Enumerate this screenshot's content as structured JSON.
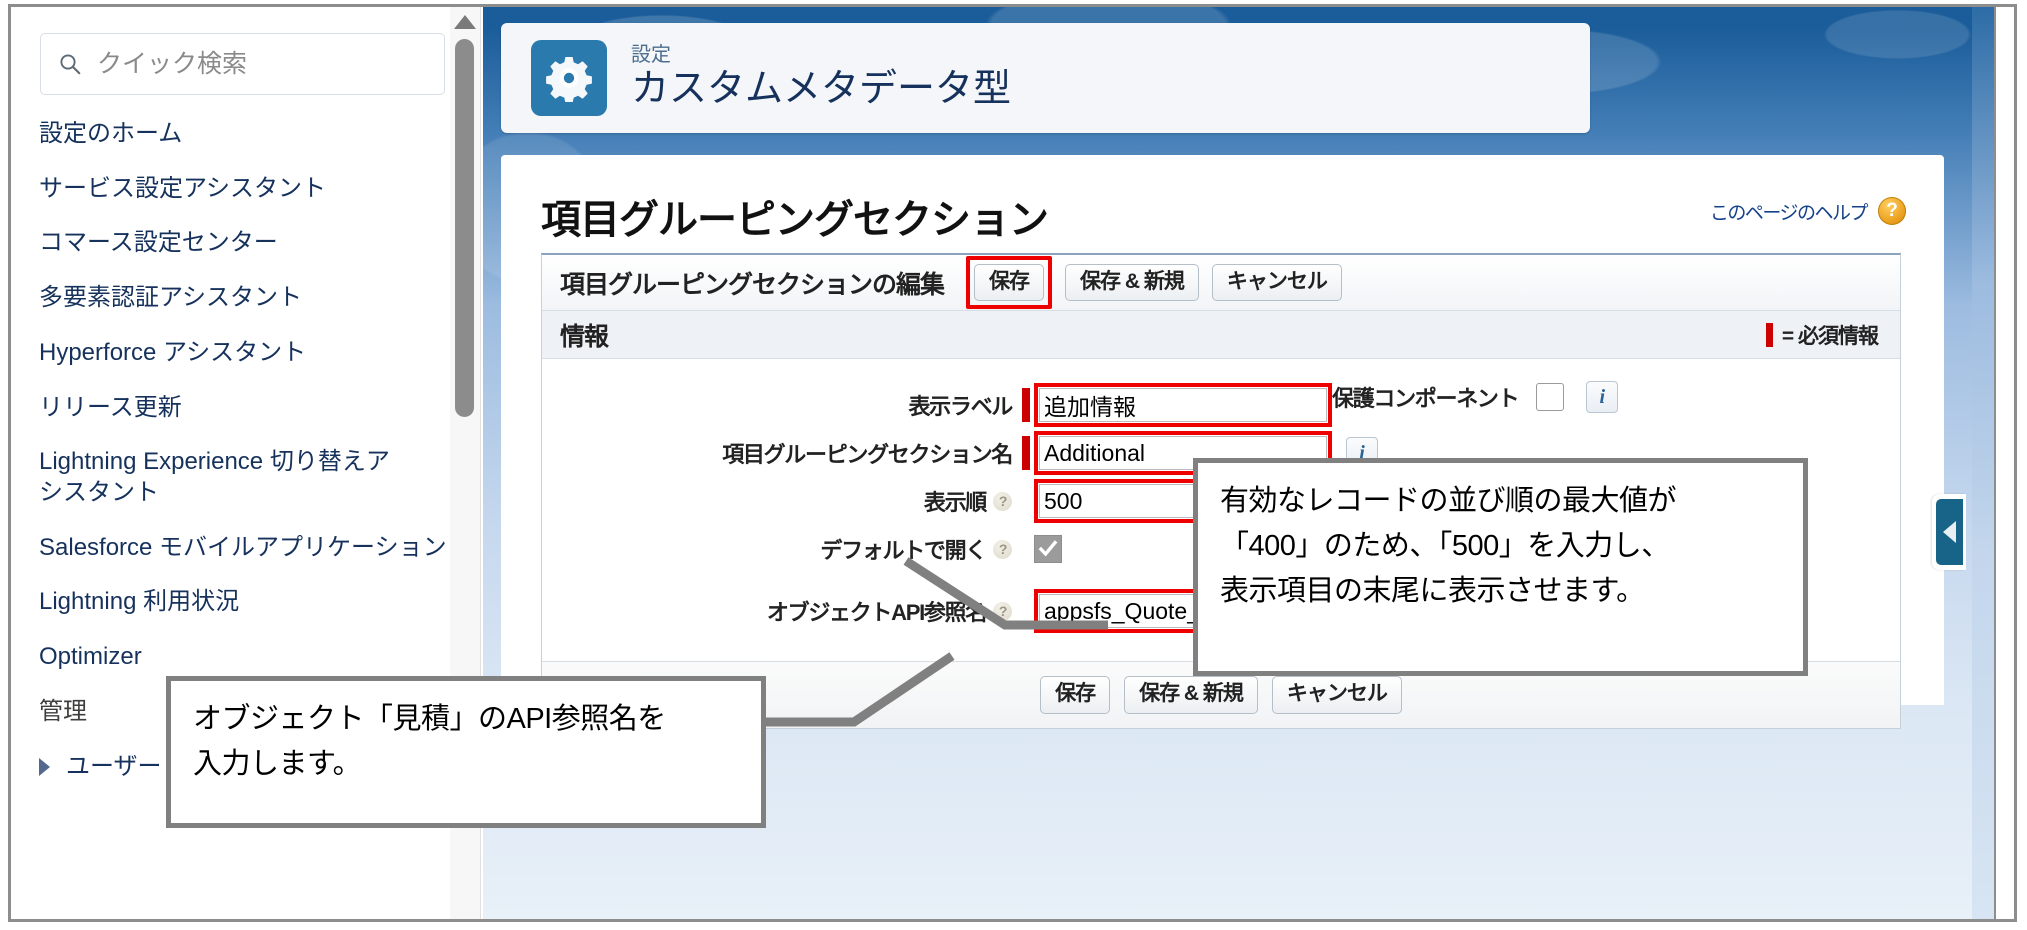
{
  "sidebar": {
    "search": {
      "placeholder": "クイック検索",
      "value": "",
      "icon": "search-icon"
    },
    "items": [
      {
        "label": "設定のホーム",
        "expandable": false
      },
      {
        "label": "サービス設定アシスタント",
        "expandable": false
      },
      {
        "label": "コマース設定センター",
        "expandable": false
      },
      {
        "label": "多要素認証アシスタント",
        "expandable": false
      },
      {
        "label": "Hyperforce アシスタント",
        "expandable": false
      },
      {
        "label": "リリース更新",
        "expandable": false
      },
      {
        "label": "Lightning Experience 切り替えアシスタント",
        "expandable": false
      },
      {
        "label": "Salesforce モバイルアプリケーション",
        "expandable": false
      },
      {
        "label": "Lightning 利用状況",
        "expandable": false
      },
      {
        "label": "Optimizer",
        "expandable": false
      },
      {
        "label": "管理",
        "expandable": false
      },
      {
        "label": "ユーザー",
        "expandable": true
      }
    ]
  },
  "header": {
    "eyebrow": "設定",
    "title": "カスタムメタデータ型",
    "icon": "gear-icon"
  },
  "page": {
    "title": "項目グルーピングセクション",
    "help_link": "このページのヘルプ",
    "help_badge": "?"
  },
  "pblock": {
    "title": "項目グルーピングセクションの編集",
    "buttons": {
      "save": "保存",
      "save_new": "保存 & 新規",
      "cancel": "キャンセル"
    },
    "section_title": "情報",
    "required_legend": "= 必須情報"
  },
  "form": {
    "fields": [
      {
        "label": "表示ラベル",
        "required": true,
        "has_help": false,
        "type": "text",
        "value": "追加情報",
        "highlighted": true,
        "has_info_icon": false
      },
      {
        "label": "項目グルーピングセクション名",
        "required": true,
        "has_help": false,
        "type": "text",
        "value": "Additional",
        "highlighted": true,
        "has_info_icon": true
      },
      {
        "label": "表示順",
        "required": false,
        "has_help": true,
        "type": "text",
        "value": "500",
        "highlighted": true,
        "has_info_icon": false
      },
      {
        "label": "デフォルトで開く",
        "required": false,
        "has_help": true,
        "type": "checkbox",
        "checked": true,
        "highlighted": false,
        "has_info_icon": false
      },
      {
        "label": "オブジェクトAPI参照名",
        "required": false,
        "has_help": true,
        "type": "text",
        "value": "appsfs_Quote_c",
        "highlighted": true,
        "has_info_icon": false
      }
    ],
    "right_column": {
      "label": "保護コンポーネント",
      "checked": false,
      "has_info_icon": true
    }
  },
  "footer": {
    "buttons": {
      "save": "保存",
      "save_new": "保存 & 新規",
      "cancel": "キャンセル"
    }
  },
  "callouts": {
    "order": {
      "lines": [
        "有効なレコードの並び順の最大値が",
        "「400」のため、「500」を入力し、",
        "表示項目の末尾に表示させます。"
      ]
    },
    "api_name": {
      "lines": [
        "オブジェクト「見積」のAPI参照名を",
        "入力します。"
      ]
    }
  },
  "colors": {
    "highlight_red": "#ee0000",
    "brand_blue": "#2a7aad",
    "callout_border": "#808080",
    "required_red": "#cc0000",
    "title_navy": "#16325c"
  },
  "misc": {
    "collapse_tab_icon": "caret-left-icon",
    "scrollbar": "vertical-scrollbar"
  }
}
